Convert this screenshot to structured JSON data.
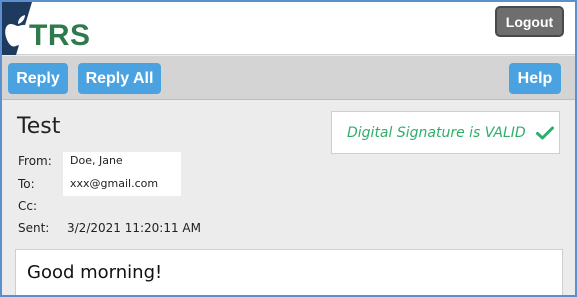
{
  "header": {
    "logo_text": "TRS",
    "logout_label": "Logout"
  },
  "toolbar": {
    "reply_label": "Reply",
    "reply_all_label": "Reply All",
    "help_label": "Help"
  },
  "message": {
    "subject": "Test",
    "signature_status": "Digital Signature is VALID",
    "from_label": "From:",
    "from_value": "Doe, Jane",
    "to_label": "To:",
    "to_value": "xxx@gmail.com",
    "cc_label": "Cc:",
    "cc_value": "",
    "sent_label": "Sent:",
    "sent_value": "3/2/2021 11:20:11 AM",
    "body": "Good morning!"
  },
  "colors": {
    "frame_border": "#5b8fd0",
    "logo_green": "#2f7a4c",
    "logo_navy": "#1f3a5f",
    "button_blue": "#4aa3e0",
    "logout_gray": "#6e6e6e",
    "valid_green": "#2fae6a"
  },
  "icons": {
    "logo": "apple-logo-icon",
    "signature": "checkmark-icon"
  }
}
